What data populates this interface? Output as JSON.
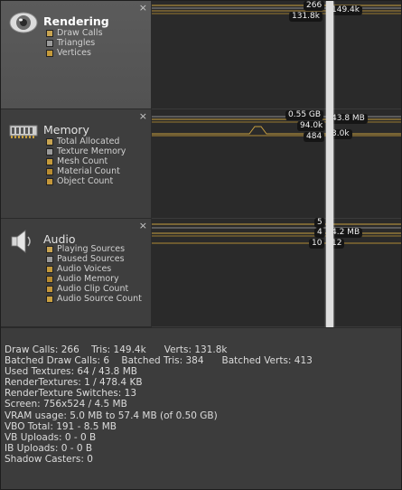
{
  "panels": {
    "rendering": {
      "title": "Rendering",
      "close": "×",
      "legend": [
        {
          "label": "Draw Calls",
          "color": "#c8a451"
        },
        {
          "label": "Triangles",
          "color": "#9a9a9a"
        },
        {
          "label": "Vertices",
          "color": "#c49a3a"
        }
      ]
    },
    "memory": {
      "title": "Memory",
      "close": "×",
      "legend": [
        {
          "label": "Total Allocated",
          "color": "#c8a451"
        },
        {
          "label": "Texture Memory",
          "color": "#9a9a9a"
        },
        {
          "label": "Mesh Count",
          "color": "#c49a3a"
        },
        {
          "label": "Material Count",
          "color": "#b88c30"
        },
        {
          "label": "Object Count",
          "color": "#c4973a"
        }
      ]
    },
    "audio": {
      "title": "Audio",
      "close": "×",
      "legend": [
        {
          "label": "Playing Sources",
          "color": "#c8a451"
        },
        {
          "label": "Paused Sources",
          "color": "#9a9a9a"
        },
        {
          "label": "Audio Voices",
          "color": "#c49a3a"
        },
        {
          "label": "Audio Memory",
          "color": "#b88c30"
        },
        {
          "label": "Audio Clip Count",
          "color": "#c4973a"
        },
        {
          "label": "Audio Source Count",
          "color": "#c9a040"
        }
      ]
    }
  },
  "graph_values": {
    "rendering": {
      "draw_calls": "266",
      "vertices": "131.8k",
      "triangles": "149.4k"
    },
    "memory": {
      "total_allocated": "0.55 GB",
      "texture_memory": "43.8 MB",
      "mesh_count": "94.0k",
      "material_count": "484",
      "object_count": "3.0k"
    },
    "audio": {
      "playing_sources": "5",
      "audio_voices": "4",
      "audio_memory": "4.2 MB",
      "audio_clip_count": "10",
      "audio_source_count": "12"
    }
  },
  "stats": {
    "lines": [
      "Draw Calls: 266    Tris: 149.4k      Verts: 131.8k",
      "Batched Draw Calls: 6    Batched Tris: 384      Batched Verts: 413",
      "Used Textures: 64 / 43.8 MB",
      "RenderTextures: 1 / 478.4 KB",
      "RenderTexture Switches: 13",
      "Screen: 756x524 / 4.5 MB",
      "VRAM usage: 5.0 MB to 57.4 MB (of 0.50 GB)",
      "VBO Total: 191 - 8.5 MB",
      "VB Uploads: 0 - 0 B",
      "IB Uploads: 0 - 0 B",
      "Shadow Casters: 0"
    ]
  },
  "colors": {
    "line_gold": "#c8a040",
    "line_gray": "#8c8c8c",
    "cursor": "#dedede"
  }
}
